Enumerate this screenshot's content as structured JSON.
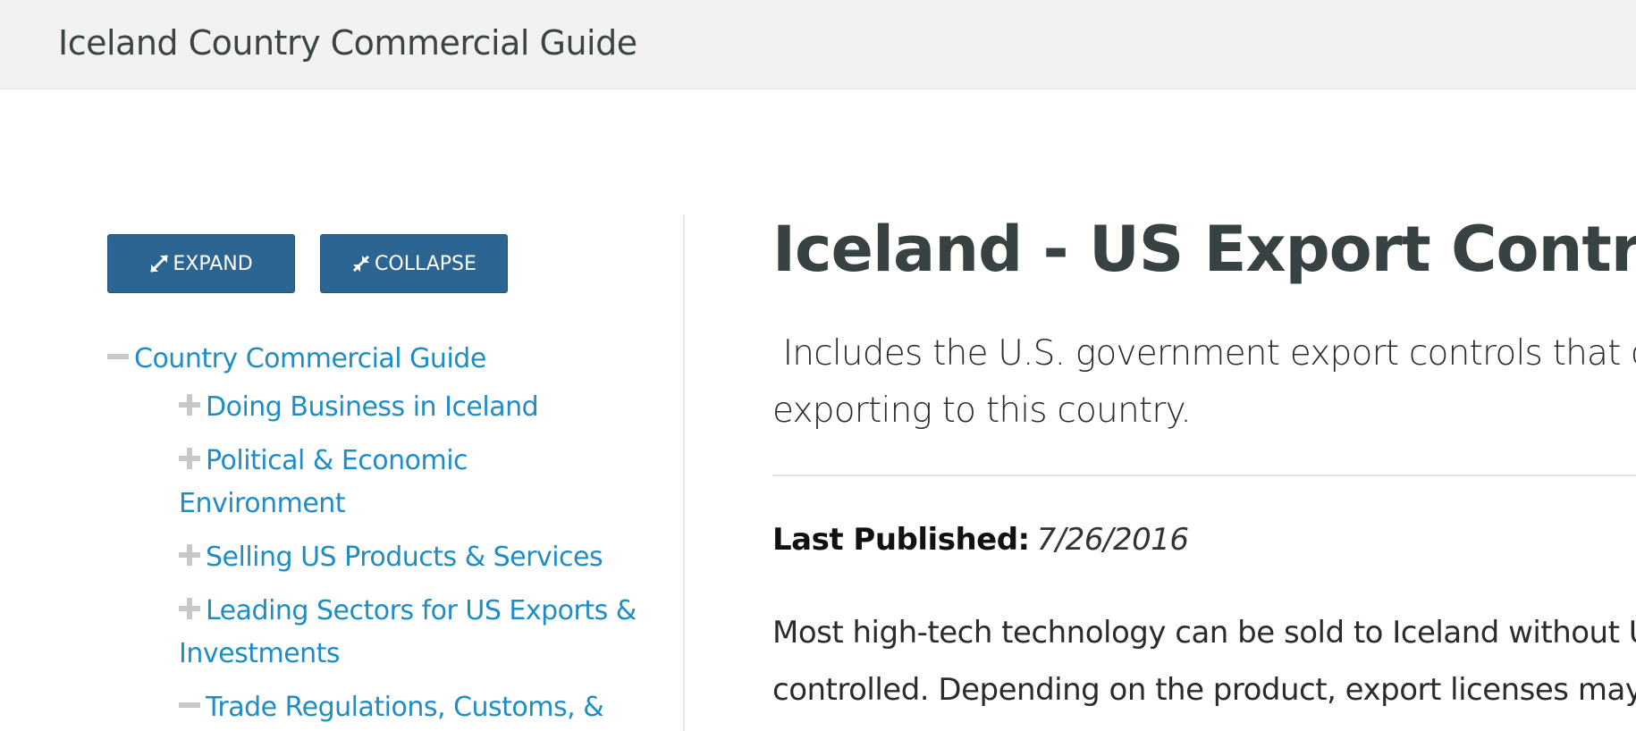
{
  "header": {
    "site_title": "Iceland Country Commercial Guide"
  },
  "toolbar": {
    "expand_label": "EXPAND",
    "collapse_label": "COLLAPSE",
    "button_color": "#2d6592"
  },
  "sidebar": {
    "items": [
      {
        "label": "Country Commercial Guide",
        "state": "expanded"
      },
      {
        "label": "Doing Business in Iceland",
        "state": "collapsed"
      },
      {
        "label_line1": "Political & Economic",
        "label_line2": "Environment",
        "state": "collapsed"
      },
      {
        "label": "Selling US Products & Services",
        "state": "collapsed"
      },
      {
        "label_line1": "Leading Sectors for US Exports &",
        "label_line2": "Investments",
        "state": "collapsed"
      },
      {
        "label": "Trade Regulations, Customs, &",
        "state": "expanded"
      }
    ],
    "link_color": "#1f8dc4"
  },
  "main": {
    "title": "Iceland - US Export Controls",
    "intro_line1": " Includes the U.S. government export controls that com",
    "intro_line2": "exporting to this country.",
    "published_label": "Last Published:",
    "published_date": "7/26/2016",
    "body_line1": "Most high-tech technology can be sold to Iceland without U.S. ex",
    "body_line2": "controlled. Depending on the product, export licenses may be iss"
  }
}
